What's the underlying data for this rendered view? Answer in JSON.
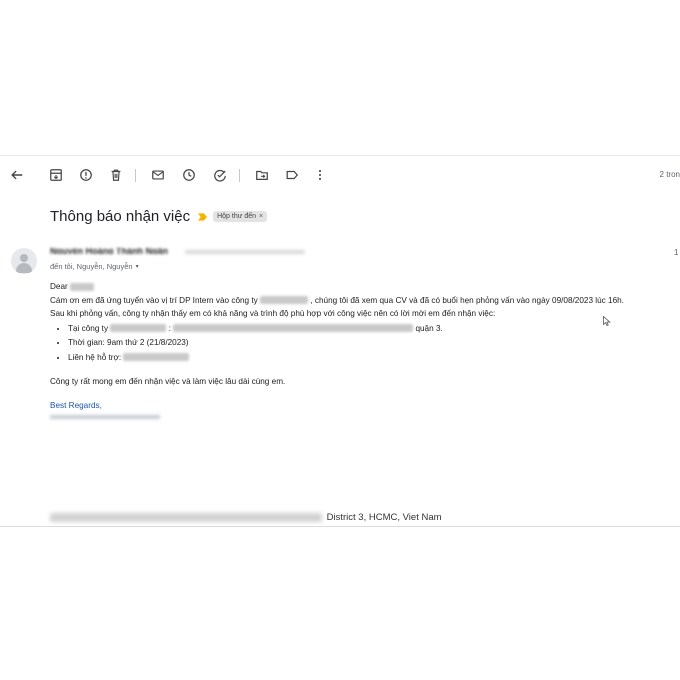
{
  "toolbar": {
    "icons": [
      "back-icon",
      "archive-icon",
      "report-spam-icon",
      "delete-icon",
      "mark-unread-icon",
      "snooze-icon",
      "add-task-icon",
      "move-to-icon",
      "label-icon",
      "more-icon"
    ],
    "pager": "2 tron"
  },
  "email": {
    "subject": "Thông báo nhận việc",
    "label": "Hộp thư đến",
    "label_close": "×",
    "sender_name": "Nguyễn Hoàng Thành Ngân",
    "recipients": "đến tôi, Nguyễn, Nguyễn",
    "recipients_caret": "▾",
    "date_fragment": "1",
    "greeting": "Dear",
    "para1_a": "Cám ơn em đã ứng tuyển vào vị trí DP Intern vào công ty",
    "para1_b": ", chúng tôi đã xem qua CV và đã có buổi hẹn phỏng vấn vào ngày 09/08/2023 lúc 16h.",
    "para2": "Sau khi phỏng vấn, công ty nhận thấy em có khả năng và trình độ phù hợp với công việc nên có lời mời em đến nhận việc:",
    "bullets": {
      "location_a": "Tại công ty",
      "location_b": ":",
      "location_c": "quận 3.",
      "time": "Thời gian: 9am thứ 2 (21/8/2023)",
      "contact": "Liên hệ hỗ trợ:"
    },
    "closing_text": "Công ty rất mong em đến nhận việc và làm việc lâu dài cùng em.",
    "regards": "Best Regards,",
    "address_tail": "District 3, HCMC, Viet Nam"
  },
  "colors": {
    "regards": "#1a56a8",
    "important_marker": "#f4b400",
    "label_chip_bg": "#e3e3e3"
  }
}
